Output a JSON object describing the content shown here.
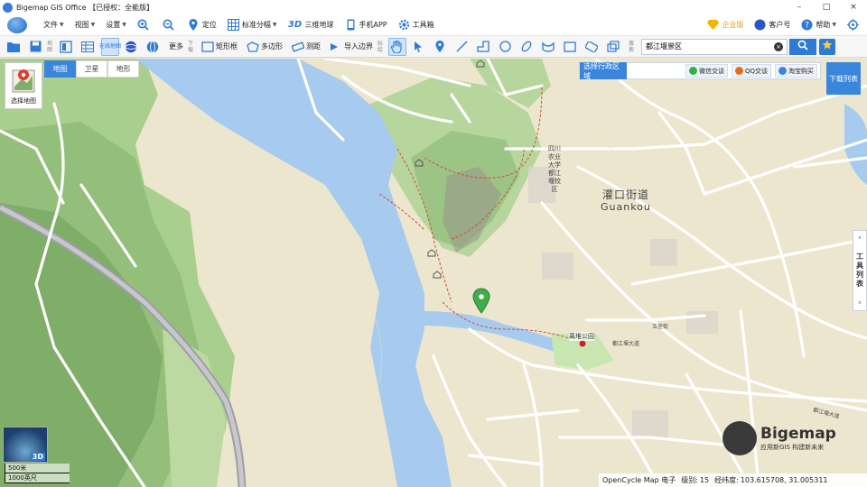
{
  "window": {
    "title": "Bigemap GIS Office 【已授权：全能版】",
    "controls": [
      "–",
      "□",
      "×"
    ]
  },
  "menu": {
    "file": "文件",
    "view": "视图",
    "settings": "设置",
    "locate": "定位",
    "standard_split": "标准分幅",
    "globe3d": "三维地球",
    "mobile_app": "手机APP",
    "toolbox": "工具箱",
    "enterprise": "企业版",
    "customer": "客户号",
    "help": "帮助"
  },
  "toolbar": {
    "map_label": "地图",
    "download_label": "下载",
    "more": "更多",
    "rect_select": "矩形框",
    "polygon": "多边形",
    "measure": "测距",
    "import_border": "导入边界",
    "annotate_label": "标绘",
    "search_label": "搜索",
    "search_value": "都江堰景区",
    "online_tag": "在线地图"
  },
  "map": {
    "select_map": "选择地图",
    "types": [
      "地图",
      "卫星",
      "地形"
    ],
    "active_type": "地图",
    "select_region": "选择行政区域",
    "share": [
      {
        "label": "微信交谈",
        "color": "#2fb24b"
      },
      {
        "label": "QQ交谈",
        "color": "#e86a1c"
      },
      {
        "label": "淘宝购买",
        "color": "#3b86dd"
      }
    ],
    "download_list": "下载列表",
    "side_panel": "工具列表",
    "minimap_tag": "3D",
    "scale": [
      "500米",
      "1000英尺"
    ],
    "labels": {
      "district_cn": "灌口街道",
      "district_en": "Guankou",
      "university": [
        "四川",
        "农业",
        "大学",
        "都江",
        "堰校",
        "区"
      ],
      "park": "离堆公园",
      "road1": "都江堰大道",
      "road2": "玉垒街",
      "road3": "都江堰大道"
    },
    "watermark": {
      "name": "Bigemap",
      "slogan": "应用新GIS 构建新未来"
    }
  },
  "status": {
    "source": "OpenCycle Map 电子",
    "level_label": "级别:",
    "level": "15",
    "coords_label": "经纬度:",
    "coords": "103.615708, 31.005311"
  }
}
